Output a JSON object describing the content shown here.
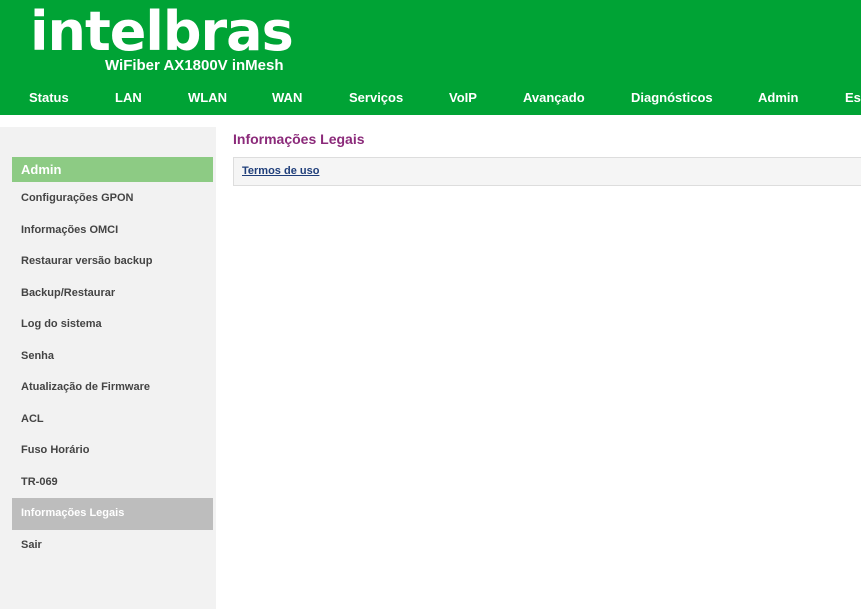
{
  "header": {
    "logo": "intelbras",
    "product": "WiFiber AX1800V inMesh",
    "nav": [
      "Status",
      "LAN",
      "WLAN",
      "WAN",
      "Serviços",
      "VoIP",
      "Avançado",
      "Diagnósticos",
      "Admin",
      "Es"
    ]
  },
  "colors": {
    "header_bg": "#00a335",
    "sidebar_header_bg": "#8dcb84",
    "sidebar_active_bg": "#bdbdbd",
    "title_color": "#8b2a7a",
    "link_color": "#1f3e7a"
  },
  "sidebar": {
    "title": "Admin",
    "items": [
      "Configurações GPON",
      "Informações OMCI",
      "Restaurar versão backup",
      "Backup/Restaurar",
      "Log do sistema",
      "Senha",
      "Atualização de Firmware",
      "ACL",
      "Fuso Horário",
      "TR-069",
      "Informações Legais",
      "Sair"
    ],
    "active_item": "Informações Legais"
  },
  "main": {
    "title": "Informações Legais",
    "link": "Termos de uso"
  }
}
